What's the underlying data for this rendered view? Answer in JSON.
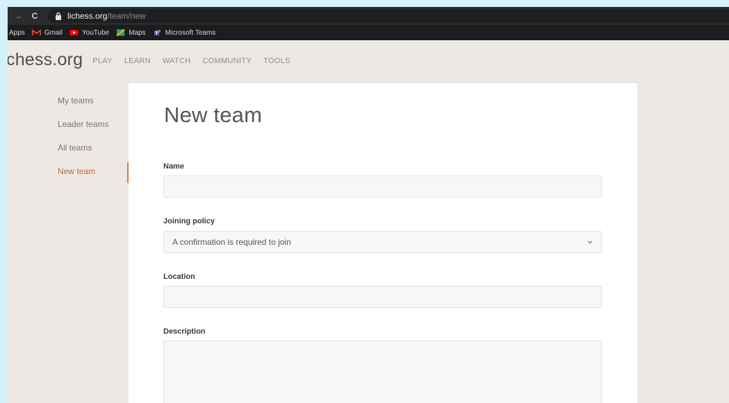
{
  "browser": {
    "url_host": "lichess.org",
    "url_path": "/team/new"
  },
  "bookmarks": [
    {
      "label": "Apps",
      "icon": "apps-grid-icon"
    },
    {
      "label": "Gmail",
      "icon": "gmail-icon",
      "color": "#ea4335"
    },
    {
      "label": "YouTube",
      "icon": "youtube-icon",
      "color": "#ff0000"
    },
    {
      "label": "Maps",
      "icon": "maps-icon",
      "color": "#34a853"
    },
    {
      "label": "Microsoft Teams",
      "icon": "teams-icon",
      "color": "#6264a7"
    }
  ],
  "site": {
    "logo": "chess.org",
    "nav": [
      "PLAY",
      "LEARN",
      "WATCH",
      "COMMUNITY",
      "TOOLS"
    ]
  },
  "side_menu": {
    "items": [
      "My teams",
      "Leader teams",
      "All teams",
      "New team"
    ],
    "active": "New team",
    "accent_color": "#c9662e"
  },
  "form": {
    "title": "New team",
    "name_label": "Name",
    "name_value": "",
    "joining_label": "Joining policy",
    "joining_value": "A confirmation is required to join",
    "location_label": "Location",
    "location_value": "",
    "description_label": "Description",
    "description_value": ""
  }
}
